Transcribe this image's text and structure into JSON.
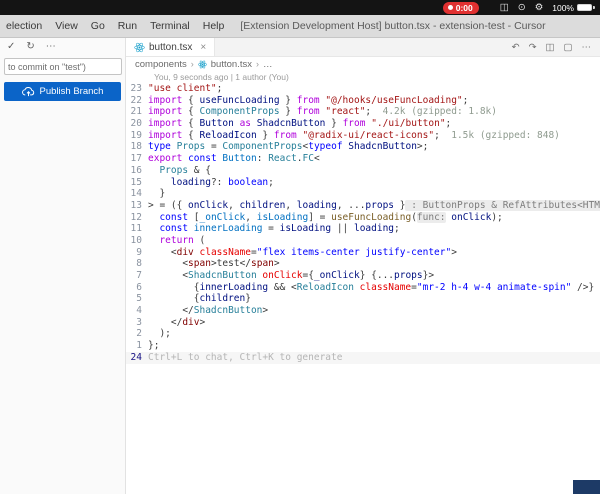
{
  "menubar": {
    "timer": "0:00",
    "battery": "100%",
    "icons": [
      {
        "name": "display-icon",
        "glyph": "◫"
      },
      {
        "name": "control-center-icon",
        "glyph": "⊙"
      },
      {
        "name": "settings-gear-icon",
        "glyph": "⚙"
      }
    ]
  },
  "titlebar": {
    "menus": [
      "election",
      "View",
      "Go",
      "Run",
      "Terminal",
      "Help"
    ],
    "title": "[Extension Development Host] button.tsx - extension-test - Cursor"
  },
  "sidebar": {
    "commit_input": "to commit on \"test\")",
    "publish_button": "Publish Branch",
    "header_icons": [
      {
        "name": "commit-check-icon",
        "glyph": "✓"
      },
      {
        "name": "refresh-icon",
        "glyph": "↻"
      },
      {
        "name": "more-actions-icon",
        "glyph": "⋯"
      }
    ]
  },
  "editor": {
    "tab": "button.tsx",
    "tab_close": "×",
    "breadcrumb": [
      "components",
      "button.tsx",
      "…"
    ],
    "chevron": "›",
    "codelens": "You, 9 seconds ago | 1 author (You)",
    "actions": [
      {
        "name": "back-icon",
        "glyph": "↶"
      },
      {
        "name": "forward-icon",
        "glyph": "↷"
      },
      {
        "name": "split-editor-icon",
        "glyph": "◫"
      },
      {
        "name": "layout-icon",
        "glyph": "▢"
      },
      {
        "name": "more-icon",
        "glyph": "⋯"
      }
    ],
    "lines": [
      {
        "n": "23",
        "seg": [
          [
            "\"use client\"",
            "s"
          ],
          [
            ";",
            "p"
          ]
        ]
      },
      {
        "n": "22",
        "seg": [
          [
            "import",
            "k"
          ],
          [
            " { ",
            "p"
          ],
          [
            "useFuncLoading",
            "v"
          ],
          [
            " } ",
            "p"
          ],
          [
            "from",
            "k"
          ],
          [
            " ",
            "p"
          ],
          [
            "\"@/hooks/useFuncLoading\"",
            "s"
          ],
          [
            ";",
            "p"
          ]
        ]
      },
      {
        "n": "21",
        "seg": [
          [
            "import",
            "k"
          ],
          [
            " { ",
            "p"
          ],
          [
            "ComponentProps",
            "t"
          ],
          [
            " } ",
            "p"
          ],
          [
            "from",
            "k"
          ],
          [
            " ",
            "p"
          ],
          [
            "\"react\"",
            "s"
          ],
          [
            ";",
            "p"
          ],
          [
            "  4.2k (gzipped: 1.8k)",
            "m"
          ]
        ]
      },
      {
        "n": "20",
        "seg": [
          [
            "import",
            "k"
          ],
          [
            " { ",
            "p"
          ],
          [
            "Button",
            "v"
          ],
          [
            " ",
            "p"
          ],
          [
            "as",
            "k"
          ],
          [
            " ",
            "p"
          ],
          [
            "ShadcnButton",
            "v"
          ],
          [
            " } ",
            "p"
          ],
          [
            "from",
            "k"
          ],
          [
            " ",
            "p"
          ],
          [
            "\"./ui/button\"",
            "s"
          ],
          [
            ";",
            "p"
          ]
        ]
      },
      {
        "n": "19",
        "seg": [
          [
            "import",
            "k"
          ],
          [
            " { ",
            "p"
          ],
          [
            "ReloadIcon",
            "v"
          ],
          [
            " } ",
            "p"
          ],
          [
            "from",
            "k"
          ],
          [
            " ",
            "p"
          ],
          [
            "\"@radix-ui/react-icons\"",
            "s"
          ],
          [
            ";",
            "p"
          ],
          [
            "  1.5k (gzipped: 848)",
            "m"
          ]
        ]
      },
      {
        "n": "18",
        "seg": [
          [
            "type",
            "b"
          ],
          [
            " ",
            "p"
          ],
          [
            "Props",
            "t"
          ],
          [
            " = ",
            "p"
          ],
          [
            "ComponentProps",
            "t"
          ],
          [
            "<",
            "p"
          ],
          [
            "typeof",
            "b"
          ],
          [
            " ",
            "p"
          ],
          [
            "ShadcnButton",
            "v"
          ],
          [
            ">;",
            "p"
          ]
        ]
      },
      {
        "n": "17",
        "seg": [
          [
            "export",
            "k"
          ],
          [
            " ",
            "p"
          ],
          [
            "const",
            "b"
          ],
          [
            " ",
            "p"
          ],
          [
            "Button",
            "c"
          ],
          [
            ": ",
            "p"
          ],
          [
            "React",
            "t"
          ],
          [
            ".",
            "p"
          ],
          [
            "FC",
            "t"
          ],
          [
            "<",
            "p"
          ]
        ]
      },
      {
        "n": "16",
        "seg": [
          [
            "  ",
            "p"
          ],
          [
            "Props",
            "t"
          ],
          [
            " & {",
            "p"
          ]
        ]
      },
      {
        "n": "15",
        "seg": [
          [
            "    ",
            "p"
          ],
          [
            "loading",
            "v"
          ],
          [
            "?: ",
            "p"
          ],
          [
            "boolean",
            "b"
          ],
          [
            ";",
            "p"
          ]
        ]
      },
      {
        "n": "14",
        "seg": [
          [
            "  }",
            "p"
          ]
        ]
      },
      {
        "n": "13",
        "seg": [
          [
            "> = ({ ",
            "p"
          ],
          [
            "onClick",
            "v"
          ],
          [
            ", ",
            "p"
          ],
          [
            "children",
            "v"
          ],
          [
            ", ",
            "p"
          ],
          [
            "loading",
            "v"
          ],
          [
            ", ...",
            "p"
          ],
          [
            "props",
            "v"
          ],
          [
            " }",
            "p"
          ],
          [
            " : ButtonProps & RefAttributes<HTMLButtonEle…",
            "i"
          ],
          [
            ") => {",
            "p"
          ]
        ]
      },
      {
        "n": "12",
        "seg": [
          [
            "  ",
            "p"
          ],
          [
            "const",
            "b"
          ],
          [
            " [",
            "p"
          ],
          [
            "_onClick",
            "c"
          ],
          [
            ", ",
            "p"
          ],
          [
            "isLoading",
            "c"
          ],
          [
            "] = ",
            "p"
          ],
          [
            "useFuncLoading",
            "f"
          ],
          [
            "(",
            "p"
          ],
          [
            "func:",
            "i"
          ],
          [
            " ",
            "p"
          ],
          [
            "onClick",
            "v"
          ],
          [
            ");",
            "p"
          ]
        ]
      },
      {
        "n": "11",
        "seg": [
          [
            "  ",
            "p"
          ],
          [
            "const",
            "b"
          ],
          [
            " ",
            "p"
          ],
          [
            "innerLoading",
            "c"
          ],
          [
            " = ",
            "p"
          ],
          [
            "isLoading",
            "v"
          ],
          [
            " || ",
            "p"
          ],
          [
            "loading",
            "v"
          ],
          [
            ";",
            "p"
          ]
        ]
      },
      {
        "n": "10",
        "seg": [
          [
            "  ",
            "p"
          ],
          [
            "return",
            "k"
          ],
          [
            " (",
            "p"
          ]
        ]
      },
      {
        "n": "9",
        "seg": [
          [
            "    <",
            "p"
          ],
          [
            "div",
            "g"
          ],
          [
            " ",
            "p"
          ],
          [
            "className",
            "a"
          ],
          [
            "=",
            "p"
          ],
          [
            "\"flex items-center justify-center\"",
            "u"
          ],
          [
            ">",
            "p"
          ]
        ]
      },
      {
        "n": "8",
        "seg": [
          [
            "      <",
            "p"
          ],
          [
            "span",
            "g"
          ],
          [
            ">",
            "p"
          ],
          [
            "test",
            "d"
          ],
          [
            "</",
            "p"
          ],
          [
            "span",
            "g"
          ],
          [
            ">",
            "p"
          ]
        ]
      },
      {
        "n": "7",
        "seg": [
          [
            "      <",
            "p"
          ],
          [
            "ShadcnButton",
            "t"
          ],
          [
            " ",
            "p"
          ],
          [
            "onClick",
            "a"
          ],
          [
            "={",
            "p"
          ],
          [
            "_onClick",
            "v"
          ],
          [
            "} {...",
            "p"
          ],
          [
            "props",
            "v"
          ],
          [
            "}>",
            "p"
          ]
        ]
      },
      {
        "n": "6",
        "seg": [
          [
            "        {",
            "p"
          ],
          [
            "innerLoading",
            "v"
          ],
          [
            " && <",
            "p"
          ],
          [
            "ReloadIcon",
            "t"
          ],
          [
            " ",
            "p"
          ],
          [
            "className",
            "a"
          ],
          [
            "=",
            "p"
          ],
          [
            "\"mr-2 h-4 w-4 animate-spin\"",
            "u"
          ],
          [
            " />}",
            "p"
          ]
        ]
      },
      {
        "n": "5",
        "seg": [
          [
            "        {",
            "p"
          ],
          [
            "children",
            "v"
          ],
          [
            "}",
            "p"
          ]
        ]
      },
      {
        "n": "4",
        "seg": [
          [
            "      </",
            "p"
          ],
          [
            "ShadcnButton",
            "t"
          ],
          [
            ">",
            "p"
          ]
        ]
      },
      {
        "n": "3",
        "seg": [
          [
            "    </",
            "p"
          ],
          [
            "div",
            "g"
          ],
          [
            ">",
            "p"
          ]
        ]
      },
      {
        "n": "2",
        "seg": [
          [
            "  );",
            "p"
          ]
        ]
      },
      {
        "n": "1",
        "seg": [
          [
            "};",
            "p"
          ]
        ]
      },
      {
        "n": "24",
        "active": true,
        "seg": [
          [
            "Ctrl+L to chat, Ctrl+K to generate",
            "h"
          ]
        ]
      }
    ]
  },
  "colors": {
    "accent_blue": "#0b64c8",
    "recording_red": "#e03131",
    "react_blue": "#149eca",
    "menubar_bg": "#141414",
    "titlebar_bg": "#dcdcdc"
  }
}
